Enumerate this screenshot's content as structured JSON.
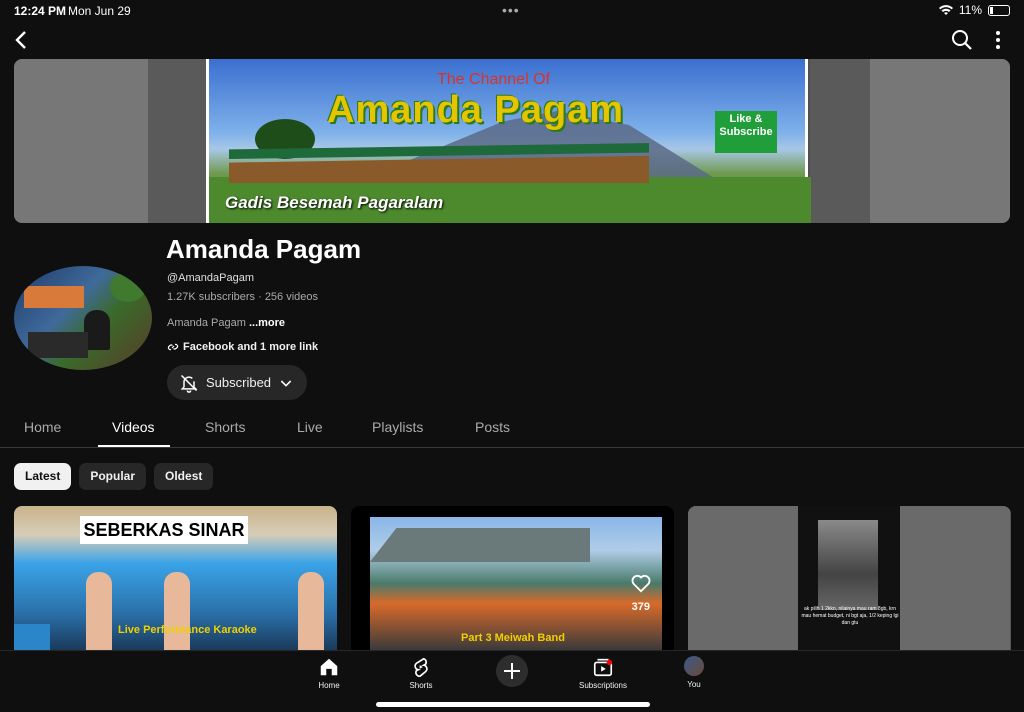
{
  "status_bar": {
    "time": "12:24 PM",
    "date": "Mon Jun 29",
    "battery": "11%"
  },
  "banner": {
    "small_title": "The Channel Of",
    "big_title": "Amanda Pagam",
    "like_box": "Like & Subscribe",
    "tagline": "Gadis Besemah Pagaralam"
  },
  "channel": {
    "name": "Amanda Pagam",
    "handle": "@AmandaPagam",
    "stats": "1.27K subscribers · 256 videos",
    "description": "Amanda Pagam",
    "more": "...more",
    "links": "Facebook and 1 more link",
    "subscribe_label": "Subscribed"
  },
  "tabs": [
    {
      "label": "Home"
    },
    {
      "label": "Videos"
    },
    {
      "label": "Shorts"
    },
    {
      "label": "Live"
    },
    {
      "label": "Playlists"
    },
    {
      "label": "Posts"
    }
  ],
  "active_tab": "Videos",
  "chips": [
    {
      "label": "Latest"
    },
    {
      "label": "Popular"
    },
    {
      "label": "Oldest"
    }
  ],
  "videos": [
    {
      "title_overlay": "SEBERKAS SINAR",
      "caption": "Live Performance Karaoke"
    },
    {
      "caption": "Part 3 Meiwah Band",
      "likes": "379"
    },
    {
      "caption": "ak pilih 1 2kkn, nilainya mau ram 8gb, krn mau hemat budget, ni bgt aja, 1/2 keping lgi dan gtu"
    }
  ],
  "bottom_nav": [
    {
      "label": "Home",
      "icon": "home-icon"
    },
    {
      "label": "Shorts",
      "icon": "shorts-icon"
    },
    {
      "label": "",
      "icon": "plus-icon"
    },
    {
      "label": "Subscriptions",
      "icon": "subscriptions-icon"
    },
    {
      "label": "You",
      "icon": "avatar"
    }
  ],
  "colors": {
    "background": "#0f0f0f",
    "chip_bg": "#272727",
    "accent_red": "#ff0000"
  }
}
